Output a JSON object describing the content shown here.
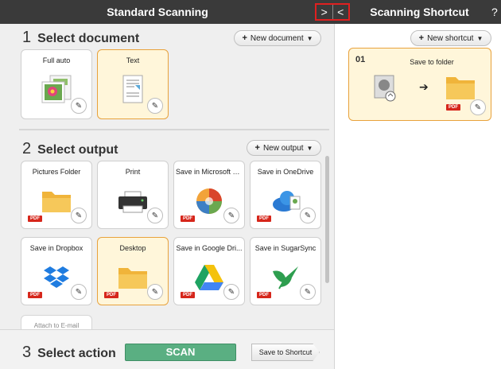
{
  "header": {
    "left_title": "Standard Scanning",
    "right_title": "Scanning Shortcut",
    "help": "?",
    "nav_next": ">",
    "nav_prev": "<"
  },
  "select_document": {
    "number": "1",
    "title": "Select document",
    "new_button": "New document",
    "cards": [
      {
        "label": "Full auto",
        "icon": "photo-stack-icon",
        "selected": false
      },
      {
        "label": "Text",
        "icon": "text-document-icon",
        "selected": true
      }
    ]
  },
  "select_output": {
    "number": "2",
    "title": "Select output",
    "new_button": "New output",
    "cards": [
      {
        "label": "Pictures Folder",
        "icon": "folder-icon",
        "pdf": "PDF",
        "selected": false
      },
      {
        "label": "Print",
        "icon": "printer-icon",
        "pdf": "",
        "selected": false
      },
      {
        "label": "Save in Microsoft S...",
        "icon": "sharepoint-icon",
        "pdf": "PDF",
        "selected": false
      },
      {
        "label": "Save in OneDrive",
        "icon": "onedrive-icon",
        "pdf": "PDF",
        "selected": false
      },
      {
        "label": "Save in Dropbox",
        "icon": "dropbox-icon",
        "pdf": "PDF",
        "selected": false
      },
      {
        "label": "Desktop",
        "icon": "folder-icon",
        "pdf": "PDF",
        "selected": true
      },
      {
        "label": "Save in Google Dri...",
        "icon": "google-drive-icon",
        "pdf": "PDF",
        "selected": false
      },
      {
        "label": "Save in SugarSync",
        "icon": "sugarsync-icon",
        "pdf": "PDF",
        "selected": false
      }
    ],
    "partial_card": "Attach to E-mail"
  },
  "select_action": {
    "number": "3",
    "title": "Select action",
    "scan": "SCAN",
    "save_to_shortcut": "Save to Shortcut"
  },
  "shortcut_panel": {
    "new_button": "New shortcut",
    "card": {
      "number": "01",
      "label": "Save to folder",
      "pdf": "PDF"
    }
  },
  "colors": {
    "accent_selected": "#e8a23c",
    "scan_green": "#5aaf82",
    "header": "#3a3a3a",
    "pdf_red": "#d6261b"
  }
}
